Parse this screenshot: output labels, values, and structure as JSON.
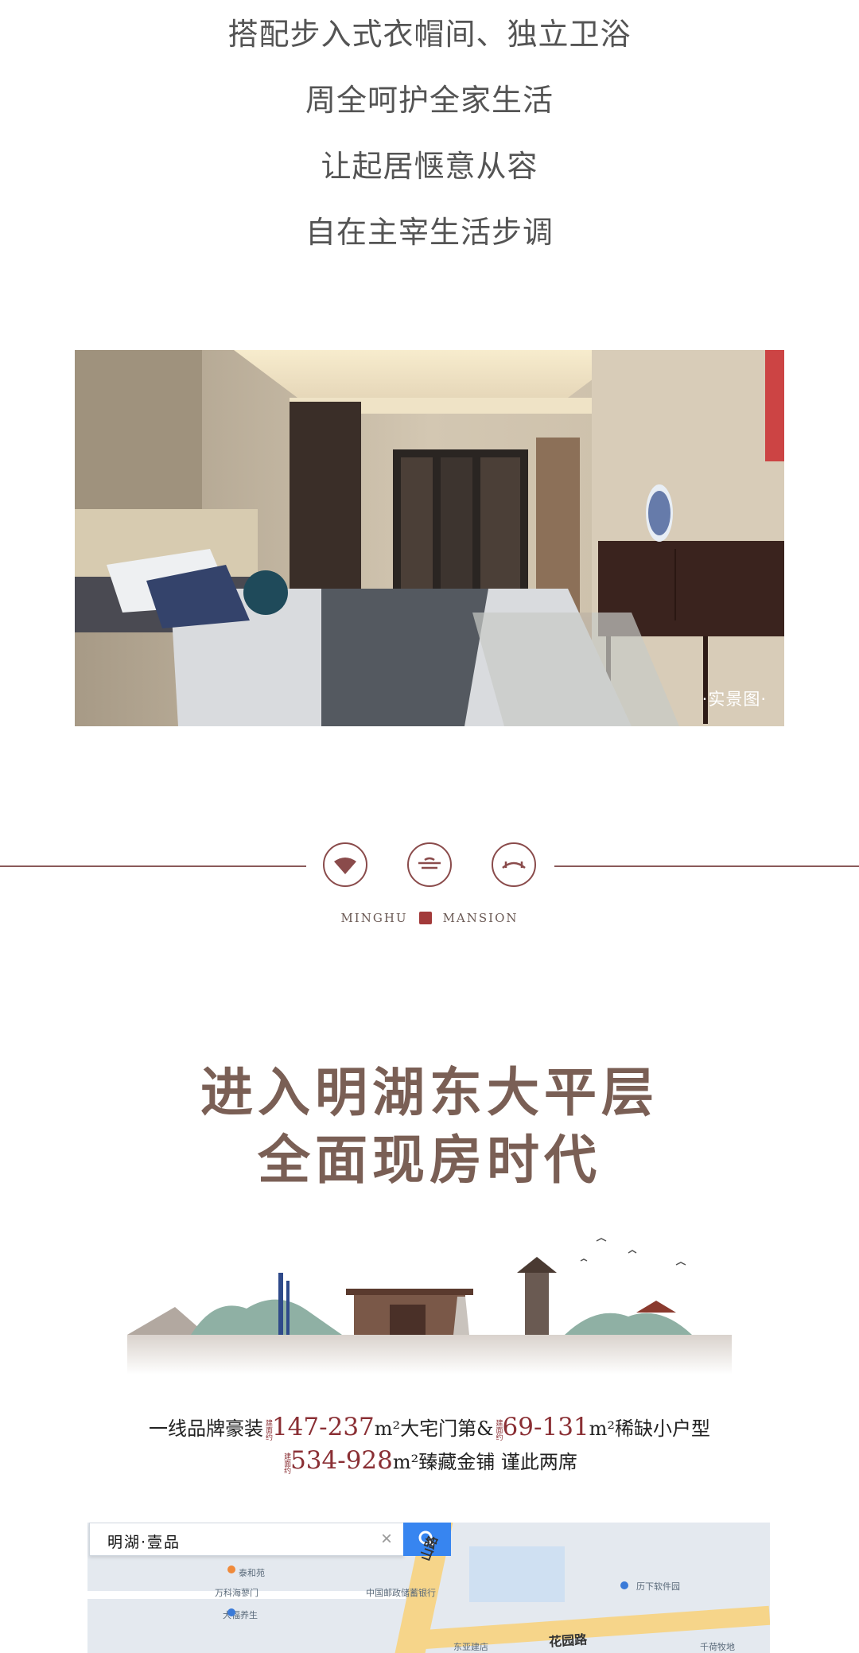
{
  "intro": {
    "lines": [
      "搭配步入式衣帽间、独立卫浴",
      "周全呵护全家生活",
      "让起居惬意从容",
      "自在主宰生活步调"
    ]
  },
  "photo": {
    "caption": "·实景图·"
  },
  "brand": {
    "left": "MINGHU",
    "right": "MANSION"
  },
  "headline": {
    "line1": "进入明湖东大平层",
    "line2": "全面现房时代"
  },
  "info": {
    "row1": {
      "prefix": "一线品牌豪装",
      "tag1": "建面约",
      "range1": "147-237",
      "unit1": "m²",
      "label1": "大宅门第&",
      "tag2": "建面约",
      "range2": "69-131",
      "unit2": "m²",
      "label2": "稀缺小户型"
    },
    "row2": {
      "tag": "建面约",
      "range": "534-928",
      "unit": "m²",
      "label": "臻藏金铺 谨此两席"
    }
  },
  "map": {
    "search_value": "明湖·壹品",
    "road_labels": [
      "山路",
      "花园路"
    ],
    "poi_labels": [
      "泰和苑",
      "万科海蓼门",
      "中国邮政储蓄银行",
      "大福养生",
      "历下软件园",
      "东亚建店",
      "千荷牧地"
    ]
  },
  "colors": {
    "accent": "#8a4b4b",
    "headline": "#7a5f55",
    "price": "#8a2f34",
    "search_button": "#3785f0"
  }
}
